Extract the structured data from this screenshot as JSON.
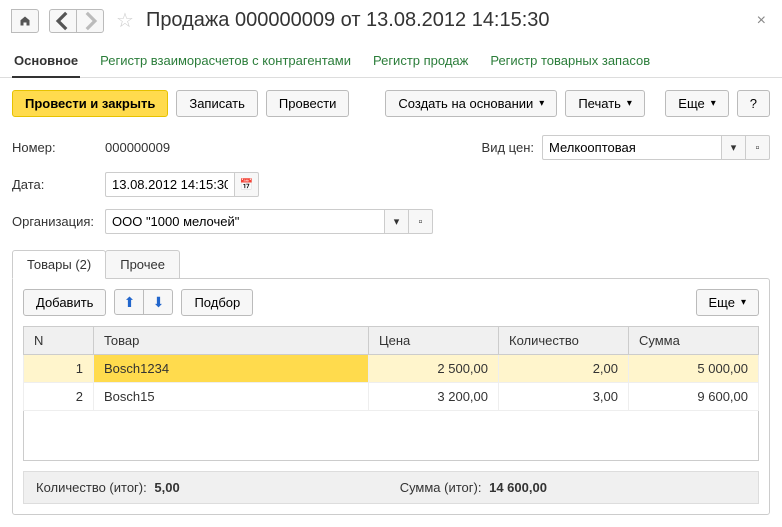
{
  "header": {
    "title": "Продажа 000000009 от 13.08.2012 14:15:30"
  },
  "navTabs": {
    "main": "Основное",
    "settlements": "Регистр взаиморасчетов с контрагентами",
    "sales": "Регистр продаж",
    "stock": "Регистр товарных запасов"
  },
  "toolbar": {
    "postClose": "Провести и закрыть",
    "save": "Записать",
    "post": "Провести",
    "createBased": "Создать на основании",
    "print": "Печать",
    "more": "Еще",
    "help": "?"
  },
  "form": {
    "numberLabel": "Номер:",
    "numberValue": "000000009",
    "priceTypeLabel": "Вид цен:",
    "priceTypeValue": "Мелкооптовая",
    "dateLabel": "Дата:",
    "dateValue": "13.08.2012 14:15:30",
    "orgLabel": "Организация:",
    "orgValue": "ООО \"1000 мелочей\""
  },
  "subTabs": {
    "goods": "Товары (2)",
    "other": "Прочее"
  },
  "panel": {
    "add": "Добавить",
    "select": "Подбор",
    "more": "Еще"
  },
  "table": {
    "headers": {
      "n": "N",
      "item": "Товар",
      "price": "Цена",
      "qty": "Количество",
      "sum": "Сумма"
    },
    "rows": [
      {
        "n": "1",
        "item": "Bosch1234",
        "price": "2 500,00",
        "qty": "2,00",
        "sum": "5 000,00"
      },
      {
        "n": "2",
        "item": "Bosch15",
        "price": "3 200,00",
        "qty": "3,00",
        "sum": "9 600,00"
      }
    ]
  },
  "totals": {
    "qtyLabel": "Количество (итог):",
    "qtyValue": "5,00",
    "sumLabel": "Сумма (итог):",
    "sumValue": "14 600,00"
  }
}
